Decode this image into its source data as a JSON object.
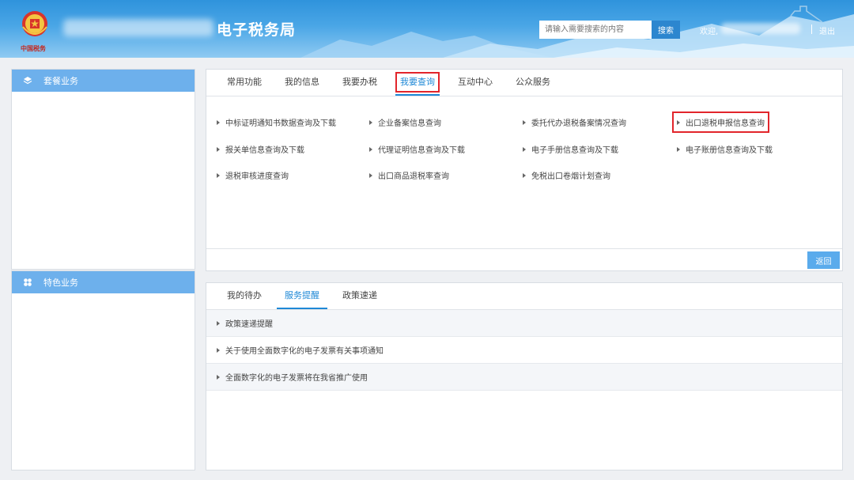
{
  "header": {
    "site_title": "电子税务局",
    "search_placeholder": "请输入需要搜索的内容",
    "search_label": "搜索",
    "welcome": "欢迎,",
    "logout": "退出",
    "emblem_caption": "中国税务"
  },
  "sidebar": {
    "package_title": "套餐业务",
    "special_title": "特色业务"
  },
  "main": {
    "tabs": [
      {
        "label": "常用功能"
      },
      {
        "label": "我的信息"
      },
      {
        "label": "我要办税"
      },
      {
        "label": "我要查询"
      },
      {
        "label": "互动中心"
      },
      {
        "label": "公众服务"
      }
    ],
    "links": [
      {
        "label": "中标证明通知书数据查询及下载"
      },
      {
        "label": "企业备案信息查询"
      },
      {
        "label": "委托代办退税备案情况查询"
      },
      {
        "label": "出口退税申报信息查询"
      },
      {
        "label": "报关单信息查询及下载"
      },
      {
        "label": "代理证明信息查询及下载"
      },
      {
        "label": "电子手册信息查询及下载"
      },
      {
        "label": "电子账册信息查询及下载"
      },
      {
        "label": "退税审核进度查询"
      },
      {
        "label": "出口商品退税率查询"
      },
      {
        "label": "免税出口卷烟计划查询"
      }
    ],
    "return_label": "返回"
  },
  "notices": {
    "tabs": [
      {
        "label": "我的待办"
      },
      {
        "label": "服务提醒"
      },
      {
        "label": "政策速递"
      }
    ],
    "items": [
      {
        "label": "政策速递提醒"
      },
      {
        "label": "关于使用全面数字化的电子发票有关事项通知"
      },
      {
        "label": "全面数字化的电子发票将在我省推广使用"
      }
    ]
  },
  "colors": {
    "header_blue": "#2f93dc",
    "panel_head": "#6db0ec",
    "accent": "#1e88d6",
    "highlight_red": "#e2252b"
  }
}
